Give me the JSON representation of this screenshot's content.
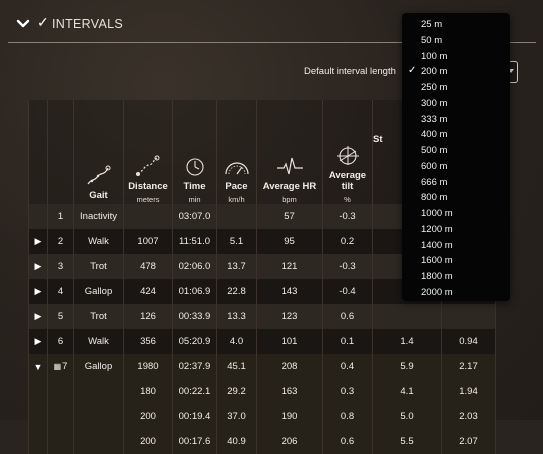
{
  "header": {
    "title": "INTERVALS",
    "checked": true
  },
  "interval_length": {
    "label": "Default interval length",
    "selected": "200 m"
  },
  "columns": [
    {
      "label": "",
      "unit": "",
      "icon": ""
    },
    {
      "label": "",
      "unit": "",
      "icon": ""
    },
    {
      "label": "Gait",
      "unit": "",
      "icon": "gait-icon"
    },
    {
      "label": "Distance",
      "unit": "meters",
      "icon": "distance-icon"
    },
    {
      "label": "Time",
      "unit": "min",
      "icon": "time-icon"
    },
    {
      "label": "Pace",
      "unit": "km/h",
      "icon": "pace-icon"
    },
    {
      "label": "Average HR",
      "unit": "bpm",
      "icon": "heart-rate-icon"
    },
    {
      "label": "Average tilt",
      "unit": "%",
      "icon": "tilt-icon"
    },
    {
      "label": "St",
      "unit": "",
      "icon": ""
    },
    {
      "label": "",
      "unit": "",
      "icon": ""
    }
  ],
  "rows": [
    {
      "expander": "",
      "num": "1",
      "gait": "Inactivity",
      "distance": "",
      "time": "03:07.0",
      "pace": "",
      "hr": "57",
      "tilt": "-0.3",
      "c9": "",
      "c10": ""
    },
    {
      "expander": "▶",
      "num": "2",
      "gait": "Walk",
      "distance": "1007",
      "time": "11:51.0",
      "pace": "5.1",
      "hr": "95",
      "tilt": "0.2",
      "c9": "",
      "c10": ""
    },
    {
      "expander": "▶",
      "num": "3",
      "gait": "Trot",
      "distance": "478",
      "time": "02:06.0",
      "pace": "13.7",
      "hr": "121",
      "tilt": "-0.3",
      "c9": "",
      "c10": ""
    },
    {
      "expander": "▶",
      "num": "4",
      "gait": "Gallop",
      "distance": "424",
      "time": "01:06.9",
      "pace": "22.8",
      "hr": "143",
      "tilt": "-0.4",
      "c9": "",
      "c10": ""
    },
    {
      "expander": "▶",
      "num": "5",
      "gait": "Trot",
      "distance": "126",
      "time": "00:33.9",
      "pace": "13.3",
      "hr": "123",
      "tilt": "0.6",
      "c9": "",
      "c10": ""
    },
    {
      "expander": "▶",
      "num": "6",
      "gait": "Walk",
      "distance": "356",
      "time": "05:20.9",
      "pace": "4.0",
      "hr": "101",
      "tilt": "0.1",
      "c9": "1.4",
      "c10": "0.94"
    },
    {
      "expander": "▼",
      "num": "7",
      "gait": "Gallop",
      "distance": "1980",
      "time": "02:37.9",
      "pace": "45.1",
      "hr": "208",
      "tilt": "0.4",
      "c9": "5.9",
      "c10": "2.17"
    },
    {
      "expander": "",
      "num": "",
      "gait": "",
      "distance": "180",
      "time": "00:22.1",
      "pace": "29.2",
      "hr": "163",
      "tilt": "0.3",
      "c9": "4.1",
      "c10": "1.94"
    },
    {
      "expander": "",
      "num": "",
      "gait": "",
      "distance": "200",
      "time": "00:19.4",
      "pace": "37.0",
      "hr": "190",
      "tilt": "0.8",
      "c9": "5.0",
      "c10": "2.03"
    },
    {
      "expander": "",
      "num": "",
      "gait": "",
      "distance": "200",
      "time": "00:17.6",
      "pace": "40.9",
      "hr": "206",
      "tilt": "0.6",
      "c9": "5.5",
      "c10": "2.07"
    }
  ],
  "dropdown": {
    "options": [
      "25 m",
      "50 m",
      "100 m",
      "200 m",
      "250 m",
      "300 m",
      "333 m",
      "400 m",
      "500 m",
      "600 m",
      "666 m",
      "800 m",
      "1000 m",
      "1200 m",
      "1400 m",
      "1600 m",
      "1800 m",
      "2000 m"
    ],
    "selected_index": 3
  },
  "colors": {
    "background": "#2a2420",
    "row_dark": "#1a1613",
    "row_light": "#2e2823",
    "dropdown_bg": "#050505"
  }
}
